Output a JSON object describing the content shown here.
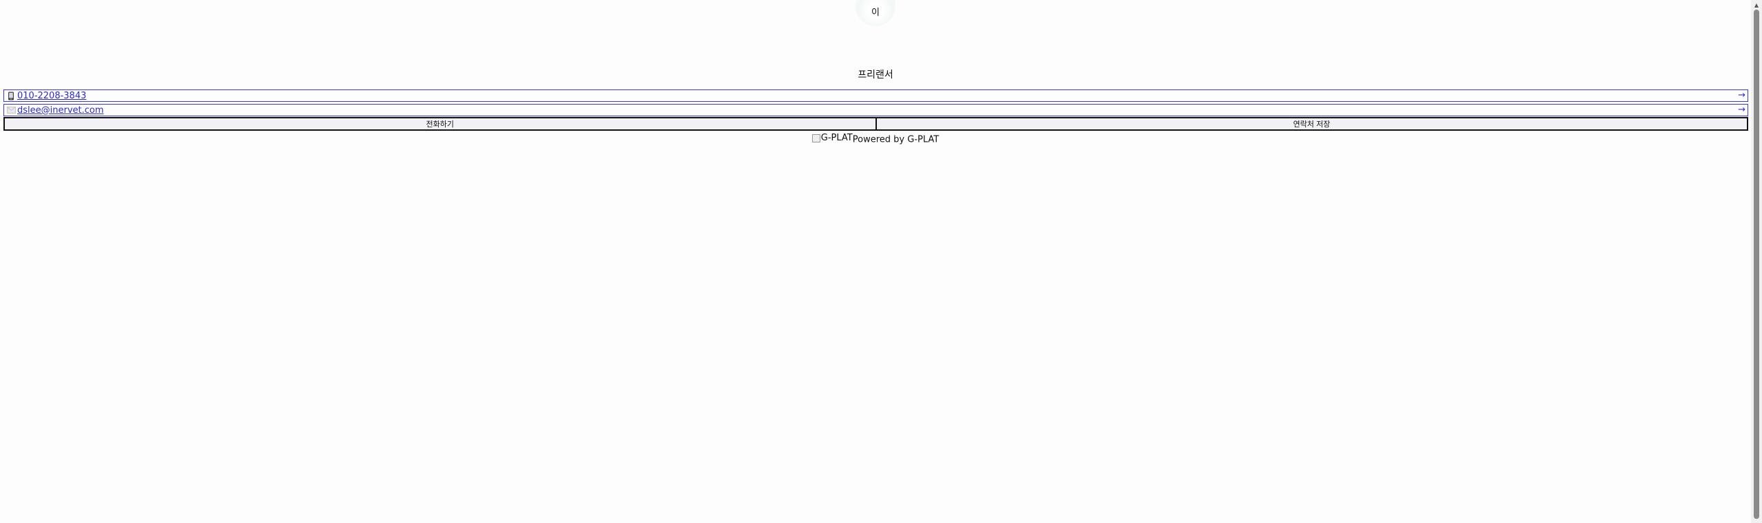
{
  "profile": {
    "avatar_initial": "이",
    "job_title": "프리랜서"
  },
  "contacts": {
    "phone": {
      "icon": "phone-icon",
      "value": "010-2208-3843",
      "arrow": "→"
    },
    "email": {
      "icon": "envelope-icon",
      "value": "dslee@inervet.com",
      "arrow": "→"
    }
  },
  "actions": {
    "call_label": "전화하기",
    "save_contact_label": "연락처 저장"
  },
  "footer": {
    "logo_alt": "G-PLAT",
    "powered_text": "Powered by G-PLAT"
  },
  "colors": {
    "link": "#2b2bd0",
    "row_border": "#3a3ad6",
    "button_bg": "#f1f1f6"
  }
}
